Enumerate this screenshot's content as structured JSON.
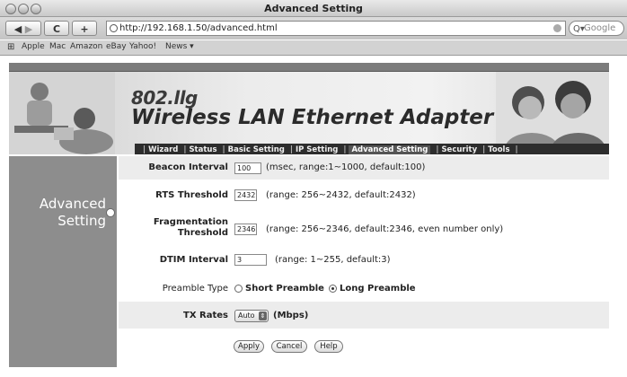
{
  "window": {
    "title": "Advanced Setting"
  },
  "toolbar": {
    "url": "http://192.168.1.50/advanced.html",
    "search_placeholder": "Google",
    "reload_label": "C",
    "add_label": "+"
  },
  "bookmarks": [
    "Apple",
    "Mac",
    "Amazon",
    "eBay",
    "Yahoo!",
    "News ▾"
  ],
  "banner": {
    "product_code": "802.llg",
    "product_name": "Wireless LAN Ethernet Adapter"
  },
  "nav": {
    "items": [
      "Wizard",
      "Status",
      "Basic Setting",
      "IP Setting",
      "Advanced Setting",
      "Security",
      "Tools"
    ],
    "active": "Advanced Setting"
  },
  "sidebar": {
    "title_line1": "Advanced",
    "title_line2": "Setting"
  },
  "form": {
    "beacon": {
      "label": "Beacon Interval",
      "value": "100",
      "hint": "(msec, range:1~1000, default:100)"
    },
    "rts": {
      "label": "RTS Threshold",
      "value": "2432",
      "hint": "(range: 256~2432, default:2432)"
    },
    "frag": {
      "label_line1": "Fragmentation",
      "label_line2": "Threshold",
      "value": "2346",
      "hint": "(range: 256~2346, default:2346, even number only)"
    },
    "dtim": {
      "label": "DTIM Interval",
      "value": "3",
      "hint": "(range: 1~255, default:3)"
    },
    "preamble": {
      "label": "Preamble Type",
      "short": "Short Preamble",
      "long": "Long Preamble",
      "selected": "Long Preamble"
    },
    "tx": {
      "label": "TX Rates",
      "value": "Auto",
      "unit": "(Mbps)"
    }
  },
  "buttons": {
    "apply": "Apply",
    "cancel": "Cancel",
    "help": "Help"
  }
}
